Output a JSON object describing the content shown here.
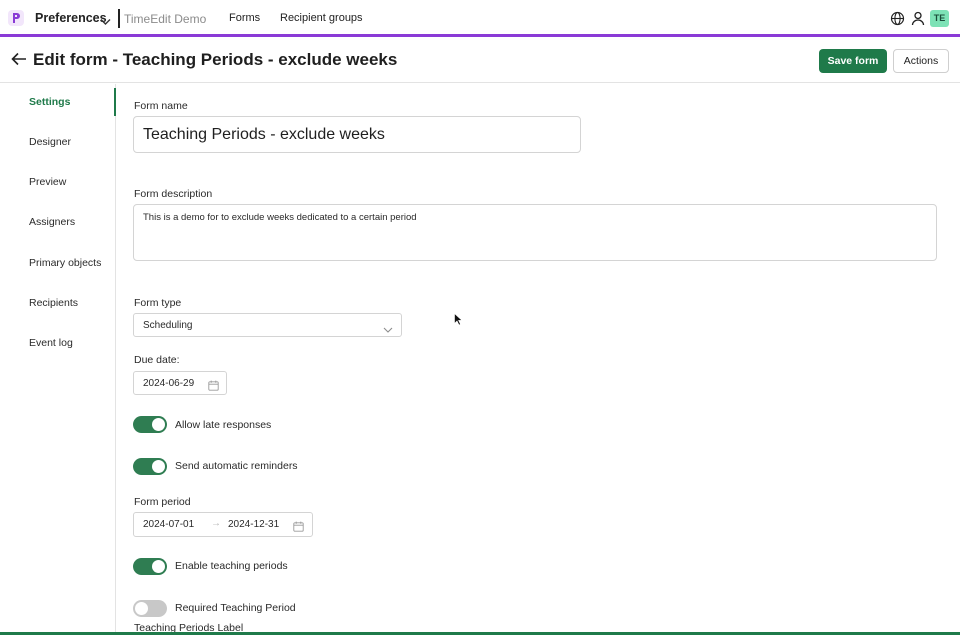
{
  "topbar": {
    "app_name": "Preferences",
    "tenant": "TimeEdit Demo",
    "nav": [
      "Forms",
      "Recipient groups"
    ],
    "badge": "TE",
    "accent_color": "#8a3ad6",
    "icons": [
      "logo-icon",
      "chevron-down-icon",
      "globe-icon",
      "user-icon"
    ]
  },
  "header": {
    "title": "Edit form - Teaching Periods - exclude weeks",
    "save_label": "Save form",
    "actions_label": "Actions",
    "primary_color": "#1f7a4a"
  },
  "sidebar": {
    "items": [
      {
        "label": "Settings",
        "active": true
      },
      {
        "label": "Designer",
        "active": false
      },
      {
        "label": "Preview",
        "active": false
      },
      {
        "label": "Assigners",
        "active": false
      },
      {
        "label": "Primary objects",
        "active": false
      },
      {
        "label": "Recipients",
        "active": false
      },
      {
        "label": "Event log",
        "active": false
      }
    ]
  },
  "form": {
    "name_label": "Form name",
    "name_value": "Teaching Periods - exclude weeks",
    "description_label": "Form description",
    "description_value": "This is a demo for to exclude weeks dedicated to a certain period",
    "type_label": "Form type",
    "type_value": "Scheduling",
    "due_label": "Due date:",
    "due_value": "2024-06-29",
    "toggles": [
      {
        "label": "Allow late responses",
        "on": true
      },
      {
        "label": "Send automatic reminders",
        "on": true
      },
      {
        "label": "Enable teaching periods",
        "on": true
      },
      {
        "label": "Required Teaching Period",
        "on": false
      }
    ],
    "period_label": "Form period",
    "period_start": "2024-07-01",
    "period_arrow": "→",
    "period_end": "2024-12-31",
    "cut_label": "Teaching Periods Label"
  }
}
